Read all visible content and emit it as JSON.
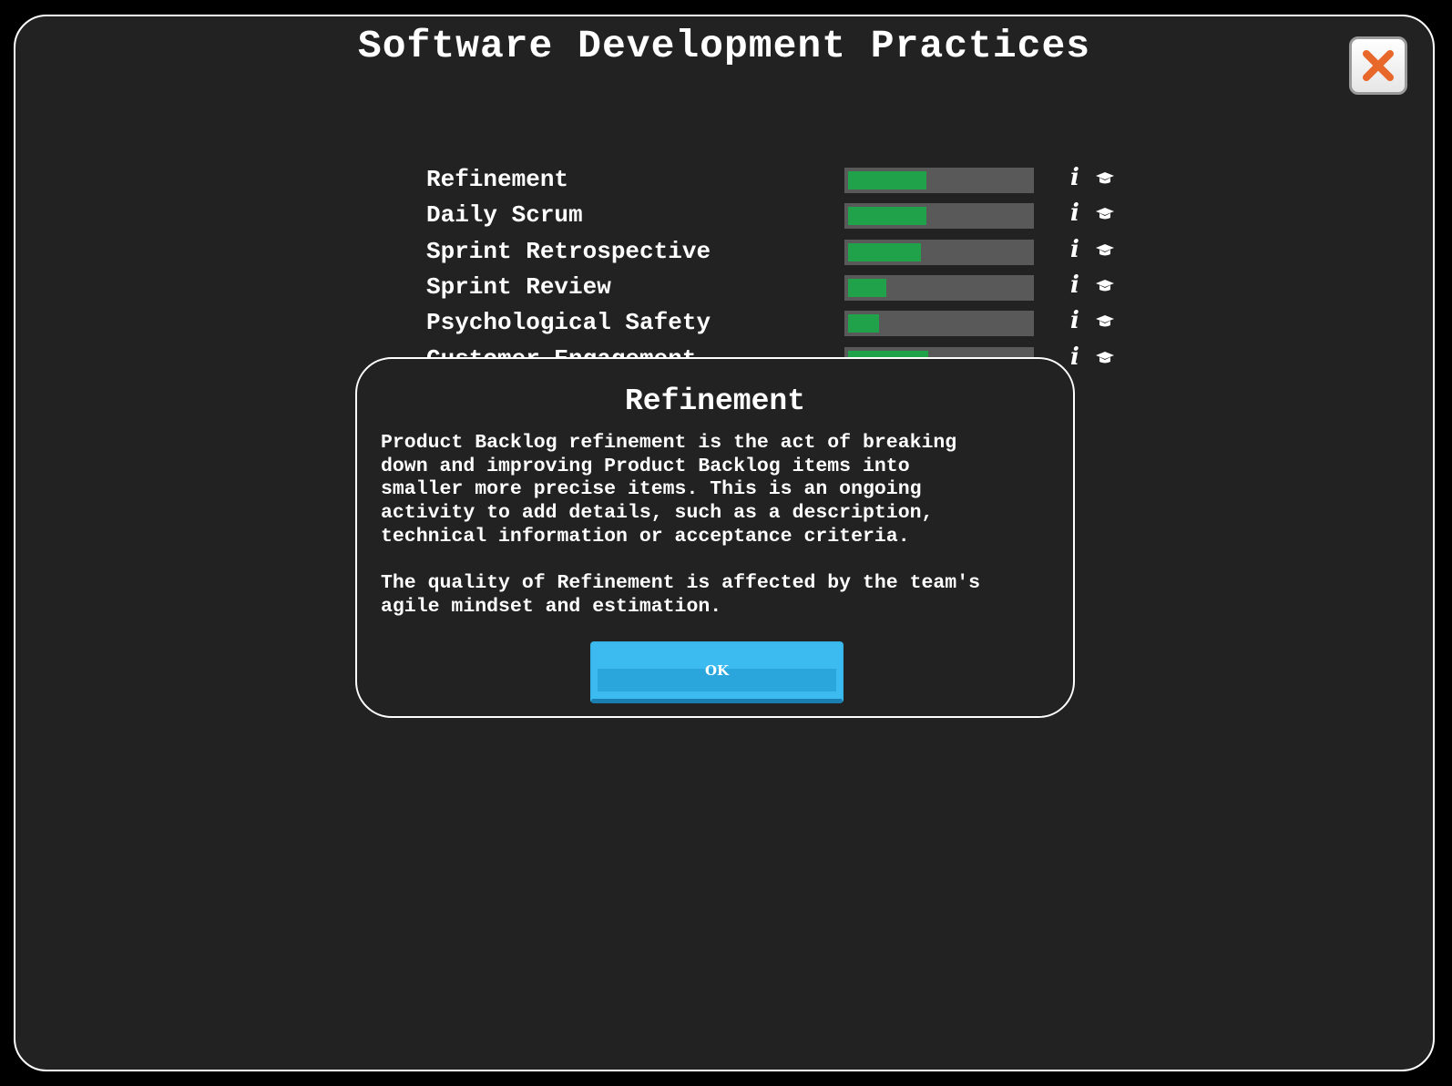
{
  "title": "Software Development Practices",
  "close_icon": "close-x-icon",
  "colors": {
    "background": "#222222",
    "meter_track": "#595959",
    "meter_fill": "#1fa24a",
    "close_x": "#e8672a",
    "ok_button": "#3bbbf0"
  },
  "practices": [
    {
      "name": "Refinement",
      "level": 0.43
    },
    {
      "name": "Daily Scrum",
      "level": 0.43
    },
    {
      "name": "Sprint Retrospective",
      "level": 0.4
    },
    {
      "name": "Sprint Review",
      "level": 0.21
    },
    {
      "name": "Psychological Safety",
      "level": 0.17
    },
    {
      "name": "Customer Engagement",
      "level": 0.44
    }
  ],
  "row_icons": {
    "info": "i",
    "learn": "graduation-cap-icon"
  },
  "dialog": {
    "title": "Refinement",
    "paragraphs": [
      "Product Backlog refinement is the act of breaking\ndown and improving Product Backlog items into\nsmaller more precise items. This is an ongoing\nactivity to add details, such as a description,\ntechnical information or acceptance criteria.",
      "The quality of Refinement is affected by the team's\nagile mindset and estimation."
    ],
    "ok_label": "OK"
  }
}
